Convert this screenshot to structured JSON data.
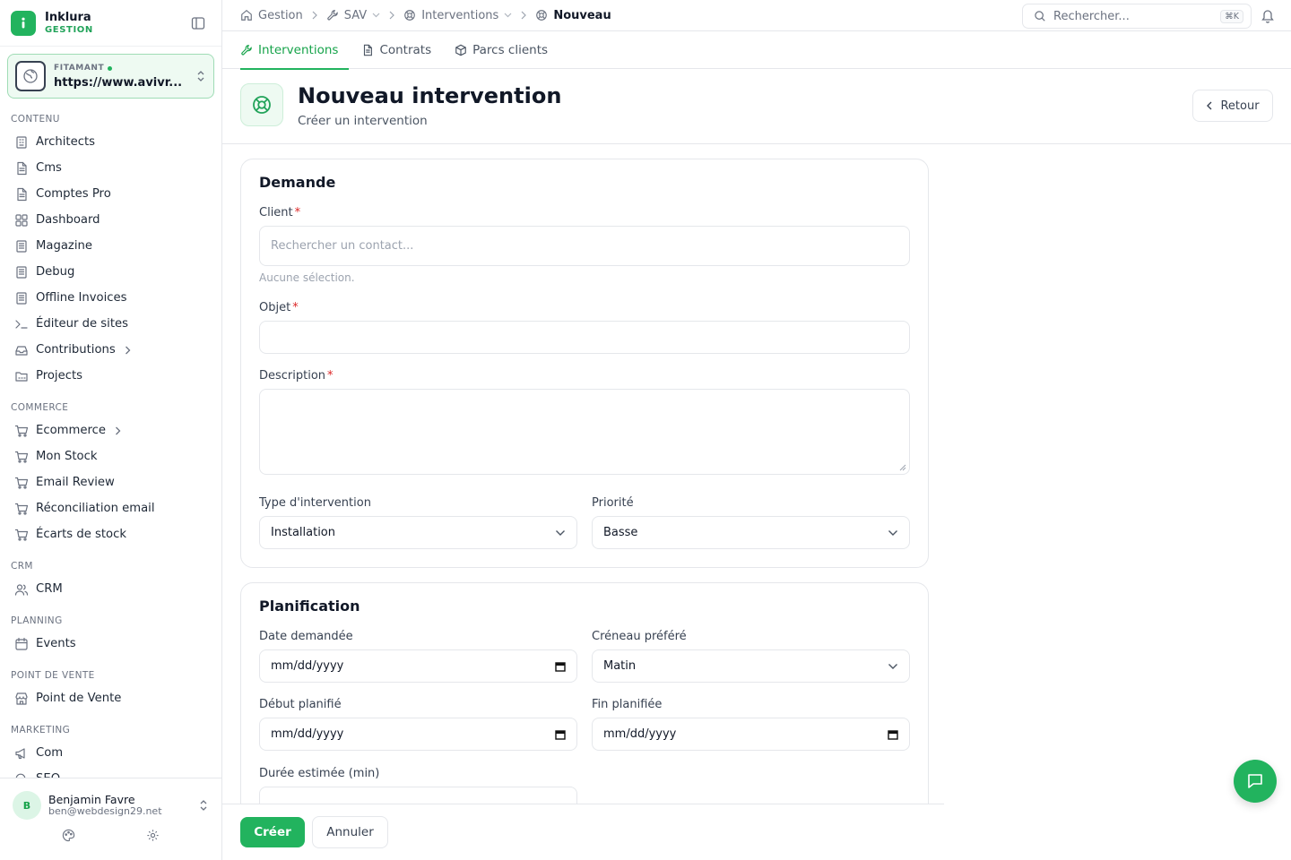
{
  "brand": {
    "name": "Inklura",
    "subtitle": "GESTION"
  },
  "site": {
    "name": "FITAMANT",
    "url": "https://www.avivr..."
  },
  "sidebar": {
    "sections": [
      {
        "title": "CONTENU",
        "items": [
          {
            "label": "Architects",
            "icon": "building-icon"
          },
          {
            "label": "Cms",
            "icon": "file-icon"
          },
          {
            "label": "Comptes Pro",
            "icon": "file-icon"
          },
          {
            "label": "Dashboard",
            "icon": "grid-icon"
          },
          {
            "label": "Magazine",
            "icon": "newspaper-icon"
          },
          {
            "label": "Debug",
            "icon": "newspaper-icon"
          },
          {
            "label": "Offline Invoices",
            "icon": "newspaper-icon"
          },
          {
            "label": "Éditeur de sites",
            "icon": "terminal-icon"
          },
          {
            "label": "Contributions",
            "icon": "inbox-icon"
          },
          {
            "label": "Projects",
            "icon": "folder-icon"
          }
        ]
      },
      {
        "title": "COMMERCE",
        "items": [
          {
            "label": "Ecommerce",
            "icon": "cart-icon"
          },
          {
            "label": "Mon Stock",
            "icon": "cart-icon"
          },
          {
            "label": "Email Review",
            "icon": "cart-icon"
          },
          {
            "label": "Réconciliation email",
            "icon": "cart-icon"
          },
          {
            "label": "Écarts de stock",
            "icon": "cart-icon"
          }
        ]
      },
      {
        "title": "CRM",
        "items": [
          {
            "label": "CRM",
            "icon": "users-icon"
          }
        ]
      },
      {
        "title": "PLANNING",
        "items": [
          {
            "label": "Events",
            "icon": "calendar-icon"
          }
        ]
      },
      {
        "title": "POINT DE VENTE",
        "items": [
          {
            "label": "Point de Vente",
            "icon": "store-icon"
          }
        ]
      },
      {
        "title": "MARKETING",
        "items": [
          {
            "label": "Com",
            "icon": "megaphone-icon"
          },
          {
            "label": "SEO",
            "icon": "search-icon"
          }
        ]
      }
    ]
  },
  "user": {
    "initial": "B",
    "name": "Benjamin Favre",
    "email": "ben@webdesign29.net"
  },
  "breadcrumb": [
    {
      "label": "Gestion",
      "icon": "home-icon"
    },
    {
      "label": "SAV",
      "icon": "wrench-icon"
    },
    {
      "label": "Interventions",
      "icon": "lifebuoy-icon"
    },
    {
      "label": "Nouveau",
      "icon": "lifebuoy-icon"
    }
  ],
  "search": {
    "placeholder": "Rechercher...",
    "shortcut": "⌘K"
  },
  "tabs": [
    {
      "label": "Interventions",
      "icon": "wrench-icon",
      "active": true
    },
    {
      "label": "Contrats",
      "icon": "file-icon",
      "active": false
    },
    {
      "label": "Parcs clients",
      "icon": "box-icon",
      "active": false
    }
  ],
  "page": {
    "title": "Nouveau intervention",
    "subtitle": "Créer un intervention",
    "back_label": "Retour"
  },
  "demande": {
    "title": "Demande",
    "client_label": "Client",
    "client_placeholder": "Rechercher un contact...",
    "client_help": "Aucune sélection.",
    "objet_label": "Objet",
    "description_label": "Description",
    "type_label": "Type d'intervention",
    "type_value": "Installation",
    "priorite_label": "Priorité",
    "priorite_value": "Basse",
    "required_mark": "*"
  },
  "planification": {
    "title": "Planification",
    "date_label": "Date demandée",
    "date_value": "mm/dd/yyyy",
    "creneau_label": "Créneau préféré",
    "creneau_value": "Matin",
    "debut_label": "Début planifié",
    "debut_value": "mm/dd/yyyy",
    "fin_label": "Fin planifiée",
    "fin_value": "mm/dd/yyyy",
    "duree_label": "Durée estimée (min)"
  },
  "actions": {
    "create": "Créer",
    "cancel": "Annuler"
  },
  "colors": {
    "accent": "#22b35e",
    "accent_text": "#16a34a",
    "required": "#dc2626"
  }
}
